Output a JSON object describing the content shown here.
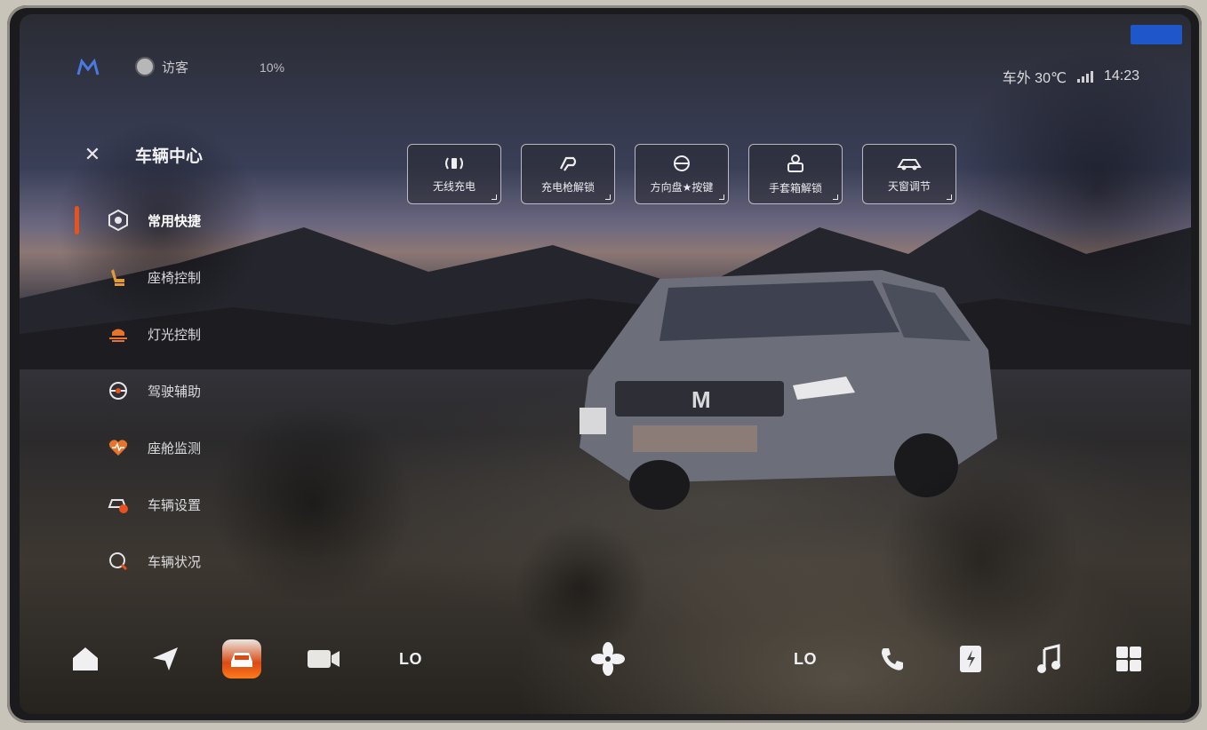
{
  "status_bar": {
    "logo_icon": "brand-m-icon",
    "guest_label": "访客",
    "battery_text": "10%",
    "outside_temp": "车外 30℃",
    "time": "14:23"
  },
  "panel": {
    "title": "车辆中心",
    "close_icon": "close-icon",
    "items": [
      {
        "label": "常用快捷",
        "icon": "shortcut-hexagon-icon",
        "active": true
      },
      {
        "label": "座椅控制",
        "icon": "seat-icon",
        "active": false
      },
      {
        "label": "灯光控制",
        "icon": "headlight-icon",
        "active": false
      },
      {
        "label": "驾驶辅助",
        "icon": "steering-wheel-icon",
        "active": false
      },
      {
        "label": "座舱监测",
        "icon": "heart-monitor-icon",
        "active": false
      },
      {
        "label": "车辆设置",
        "icon": "car-settings-icon",
        "active": false
      },
      {
        "label": "车辆状况",
        "icon": "car-status-icon",
        "active": false
      }
    ]
  },
  "quick_tiles": [
    {
      "label": "无线充电",
      "icon": "wireless-charging-icon"
    },
    {
      "label": "充电枪解锁",
      "icon": "charging-gun-icon"
    },
    {
      "label": "方向盘★按键",
      "icon": "steering-key-icon"
    },
    {
      "label": "手套箱解锁",
      "icon": "glovebox-icon"
    },
    {
      "label": "天窗调节",
      "icon": "sunroof-icon"
    }
  ],
  "dock": {
    "items": [
      {
        "name": "home-icon"
      },
      {
        "name": "navigation-icon"
      },
      {
        "name": "vehicle-icon",
        "active": true
      },
      {
        "name": "camera-icon"
      },
      {
        "name": "left-temp",
        "text": "LO"
      },
      {
        "name": "fan-icon"
      },
      {
        "name": "right-temp",
        "text": "LO"
      },
      {
        "name": "phone-icon"
      },
      {
        "name": "charging-icon"
      },
      {
        "name": "music-icon"
      },
      {
        "name": "apps-grid-icon"
      }
    ]
  },
  "colors": {
    "accent": "#e8521f",
    "indicator": "#1f56c9"
  }
}
